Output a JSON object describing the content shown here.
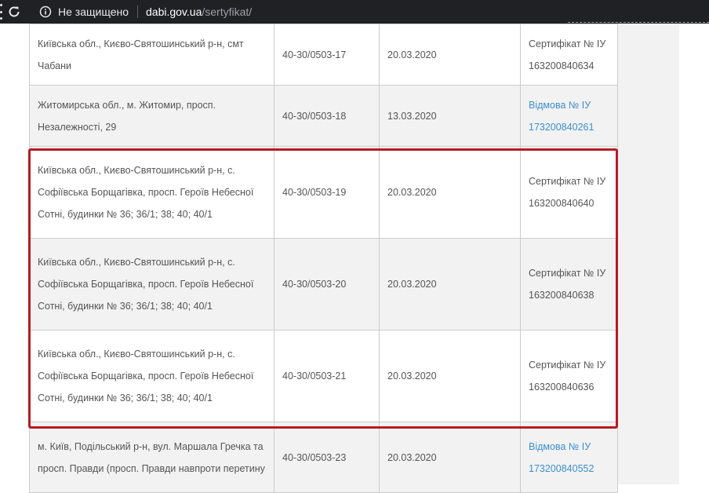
{
  "browser": {
    "security_text": "Не защищено",
    "url_host": "dabi.gov.ua",
    "url_path": "/sertyfikat/"
  },
  "table": {
    "rows": [
      {
        "address": "Київська обл., Києво-Святошинський р-н, смт Чабани",
        "number": "40-30/0503-17",
        "date": "20.03.2020",
        "doc": "Сертифікат № ІУ 163200840634",
        "doc_is_link": false
      },
      {
        "address": "Житомирська обл., м. Житомир, просп. Незалежності, 29",
        "number": "40-30/0503-18",
        "date": "13.03.2020",
        "doc": "Відмова № ІУ 173200840261",
        "doc_is_link": true
      },
      {
        "address": "Київська обл., Києво-Святошинський р-н, с. Софіївська Борщагівка, просп. Героїв Небесної Сотні, будинки № 36; 36/1; 38; 40; 40/1",
        "number": "40-30/0503-19",
        "date": "20.03.2020",
        "doc": "Сертифікат № ІУ 163200840640",
        "doc_is_link": false
      },
      {
        "address": "Київська обл., Києво-Святошинський р-н, с. Софіївська Борщагівка, просп. Героїв Небесної Сотні, будинки № 36; 36/1; 38; 40; 40/1",
        "number": "40-30/0503-20",
        "date": "20.03.2020",
        "doc": "Сертифікат № ІУ 163200840638",
        "doc_is_link": false
      },
      {
        "address": "Київська обл., Києво-Святошинський р-н, с. Софіївська Борщагівка, просп. Героїв Небесної Сотні, будинки № 36; 36/1; 38; 40; 40/1",
        "number": "40-30/0503-21",
        "date": "20.03.2020",
        "doc": "Сертифікат № ІУ 163200840636",
        "doc_is_link": false
      },
      {
        "address": "м. Київ, Подільський р-н, вул. Маршала Гречка та просп. Правди (просп. Правди навпроти перетину",
        "number": "40-30/0503-23",
        "date": "20.03.2020",
        "doc": "Відмова № ІУ 173200840552",
        "doc_is_link": true
      }
    ]
  },
  "colors": {
    "link": "#3b8fd3",
    "highlight": "#b51c22",
    "toolbar": "#202124"
  }
}
